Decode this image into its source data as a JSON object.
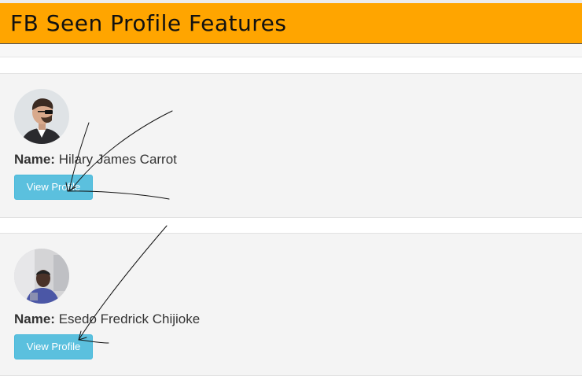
{
  "header": {
    "title": "FB Seen Profile Features",
    "bg_color": "#ffa500"
  },
  "profiles": [
    {
      "name_label": "Name:",
      "name": "Hilary James Carrot",
      "button_label": "View Profile"
    },
    {
      "name_label": "Name:",
      "name": "Esedo Fredrick Chijioke",
      "button_label": "View Profile"
    }
  ],
  "colors": {
    "button": "#5bc0de",
    "card_bg": "#f4f4f4"
  }
}
